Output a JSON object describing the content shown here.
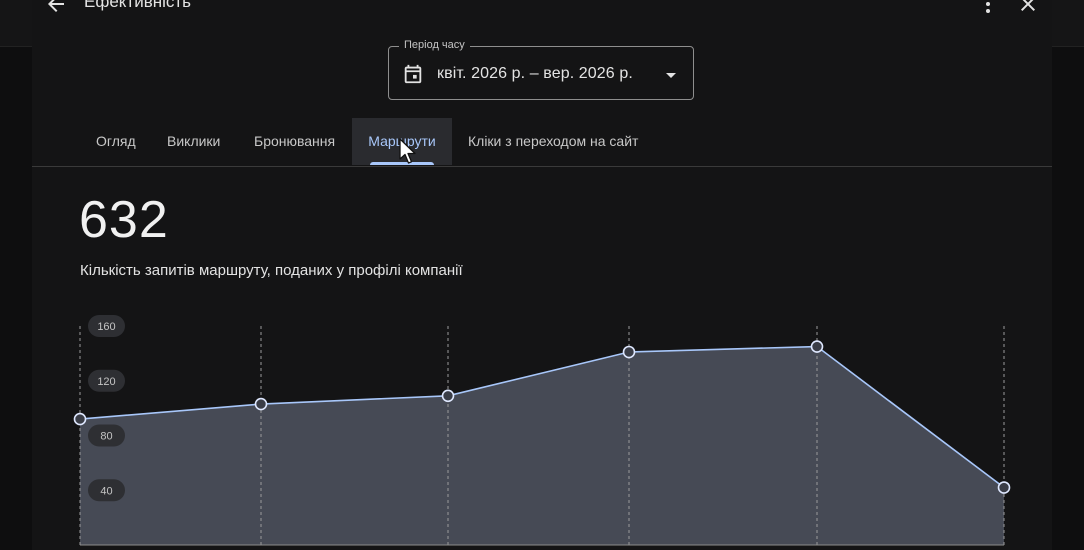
{
  "header": {
    "title": "Ефективність",
    "back_icon": "arrow-left-icon",
    "more_icon": "more-vert-icon",
    "close_icon": "close-icon"
  },
  "period": {
    "label": "Період часу",
    "value": "квіт. 2026 р. – вер. 2026 р.",
    "icon": "calendar-icon"
  },
  "tabs": [
    {
      "label": "Огляд",
      "active": false
    },
    {
      "label": "Виклики",
      "active": false
    },
    {
      "label": "Бронювання",
      "active": false
    },
    {
      "label": "Маршрути",
      "active": true
    },
    {
      "label": "Кліки з переходом на сайт",
      "active": false
    }
  ],
  "metric": {
    "value": "632",
    "caption": "Кількість запитів маршруту, поданих у профілі компанії"
  },
  "colors": {
    "accent": "#a8c7fa",
    "fill": "#464a55",
    "line": "#a8c7fa"
  },
  "chart_data": {
    "type": "area",
    "x_index": [
      0,
      1,
      2,
      3,
      4,
      5
    ],
    "values": [
      92,
      103,
      109,
      141,
      145,
      42
    ],
    "ylim": [
      0,
      160
    ],
    "y_ticks": [
      "40",
      "80",
      "120",
      "160"
    ],
    "grid": "vertical-dashed"
  }
}
